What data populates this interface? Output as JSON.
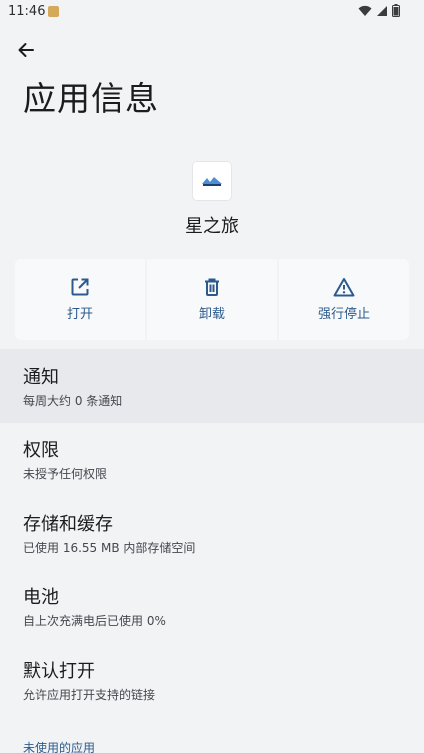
{
  "status_bar": {
    "time": "11:46",
    "icons": [
      "wifi-icon",
      "signal-icon",
      "battery-icon"
    ]
  },
  "header": {
    "title": "应用信息"
  },
  "app": {
    "name": "星之旅"
  },
  "actions": [
    {
      "label": "打开",
      "icon": "open-external-icon"
    },
    {
      "label": "卸载",
      "icon": "trash-icon"
    },
    {
      "label": "强行停止",
      "icon": "warning-icon"
    }
  ],
  "settings": [
    {
      "title": "通知",
      "subtitle": "每周大约 0 条通知"
    },
    {
      "title": "权限",
      "subtitle": "未授予任何权限"
    },
    {
      "title": "存储和缓存",
      "subtitle": "已使用 16.55 MB 内部存储空间"
    },
    {
      "title": "电池",
      "subtitle": "自上次充满电后已使用 0%"
    },
    {
      "title": "默认打开",
      "subtitle": "允许应用打开支持的链接"
    }
  ],
  "section": {
    "unused_apps": "未使用的应用"
  },
  "colors": {
    "accent": "#2c5a8c",
    "background": "#f2f3f5",
    "highlight_row": "#e8e9ec"
  }
}
